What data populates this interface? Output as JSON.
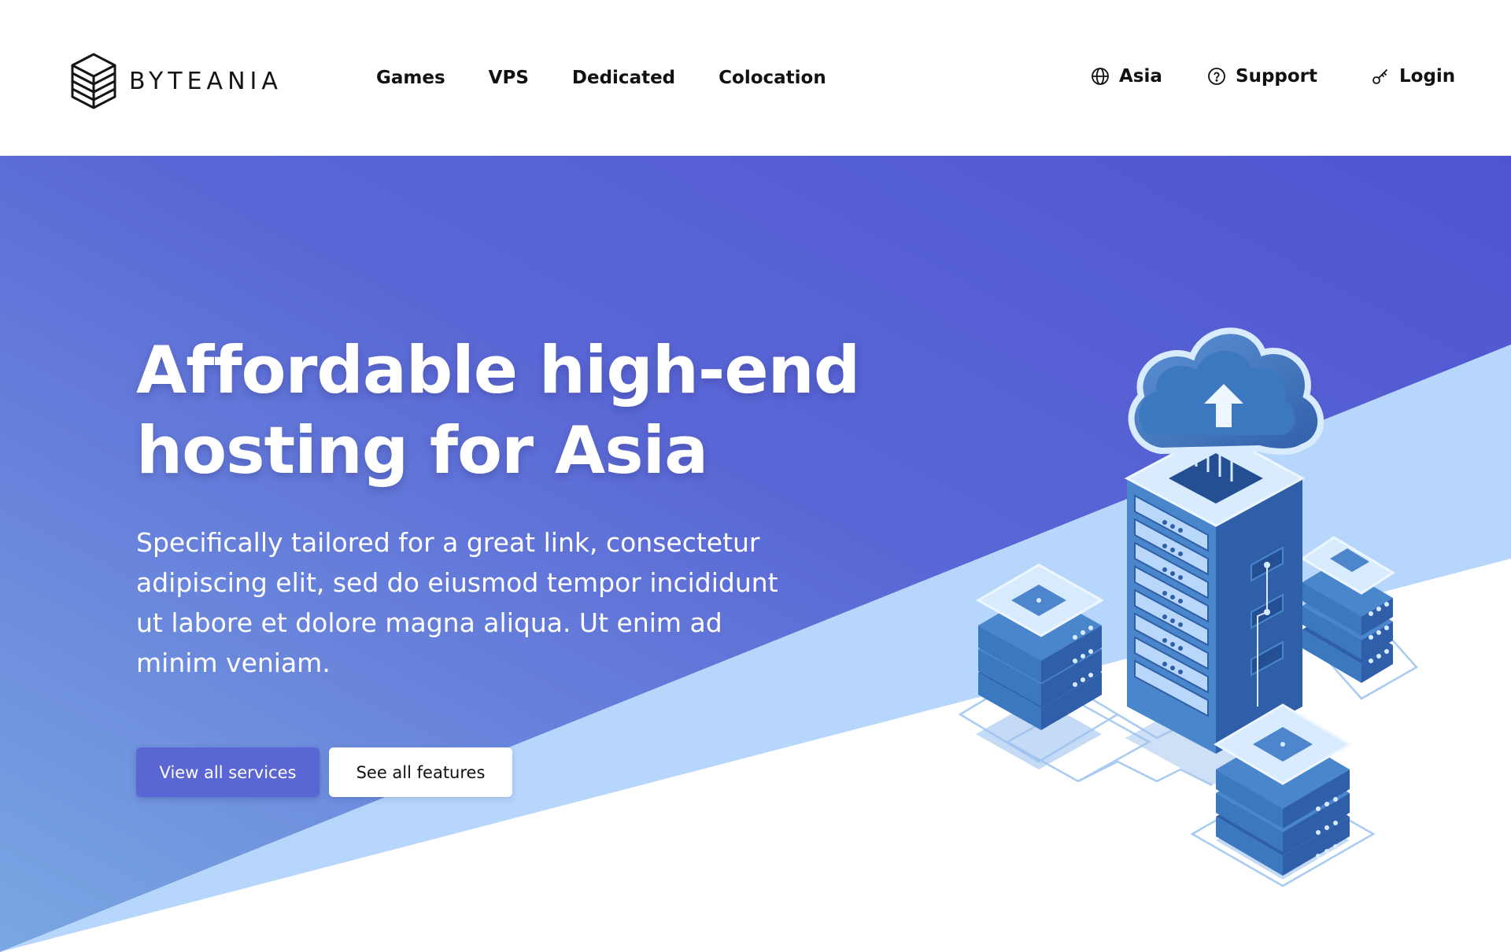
{
  "brand": {
    "name": "BYTEANIA"
  },
  "nav": {
    "main": [
      "Games",
      "VPS",
      "Dedicated",
      "Colocation"
    ],
    "region": {
      "label": "Asia",
      "icon": "globe-icon"
    },
    "support": {
      "label": "Support",
      "icon": "help-circle-icon"
    },
    "login": {
      "label": "Login",
      "icon": "key-icon"
    }
  },
  "hero": {
    "title_line1": "Affordable high-end",
    "title_line2": "hosting for Asia",
    "subtitle": "Specifically tailored for a great link, consectetur adipiscing elit, sed do eiusmod tempor incididunt ut labore et dolore magna aliqua. Ut enim ad minim veniam.",
    "primary_button": "View all services",
    "secondary_button": "See all features",
    "illustration": "isometric-server-cloud-illustration"
  },
  "colors": {
    "gradient_start": "#7aa7e2",
    "gradient_end": "#4f55d0",
    "light_band": "#b6d6fb",
    "primary_button": "#5a66d4",
    "server_dark": "#2f5fa8",
    "server_mid": "#3c78c0",
    "server_light": "#d9ebfe"
  }
}
